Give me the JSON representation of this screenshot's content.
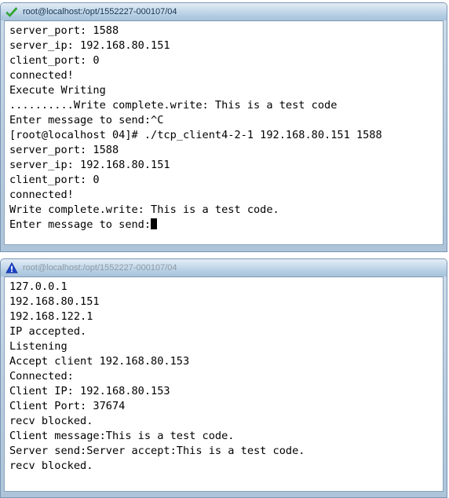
{
  "windows": [
    {
      "id": "client-terminal",
      "title": "root@localhost:/opt/1552227-000107/04",
      "icon": "green-check-icon",
      "state": "active",
      "lines": [
        "server_port: 1588",
        "server_ip: 192.168.80.151",
        "client_port: 0",
        "connected!",
        "Execute Writing",
        "..........Write complete.write: This is a test code",
        "Enter message to send:^C",
        "[root@localhost 04]# ./tcp_client4-2-1 192.168.80.151 1588",
        "server_port: 1588",
        "server_ip: 192.168.80.151",
        "client_port: 0",
        "connected!",
        "Write complete.write: This is a test code.",
        "Enter message to send:"
      ],
      "cursor_on_last_line": true
    },
    {
      "id": "server-terminal",
      "title": "root@localhost:/opt/1552227-000107/04",
      "icon": "blue-warning-icon",
      "state": "inactive",
      "lines": [
        "127.0.0.1",
        "192.168.80.151",
        "192.168.122.1",
        "IP accepted.",
        "Listening",
        "Accept client 192.168.80.153",
        "Connected:",
        "Client IP: 192.168.80.153",
        "Client Port: 37674",
        "recv blocked.",
        "Client message:This is a test code.",
        "Server send:Server accept:This is a test code.",
        "recv blocked."
      ],
      "cursor_on_last_line": false
    }
  ],
  "colors": {
    "title_active_text": "#16344f",
    "title_inactive_text": "#8d9aa6",
    "window_border": "#7a96b4",
    "terminal_bg": "#ffffff",
    "terminal_fg": "#000000",
    "check_icon": "#2fb62f",
    "warning_icon": "#1b43c8"
  }
}
